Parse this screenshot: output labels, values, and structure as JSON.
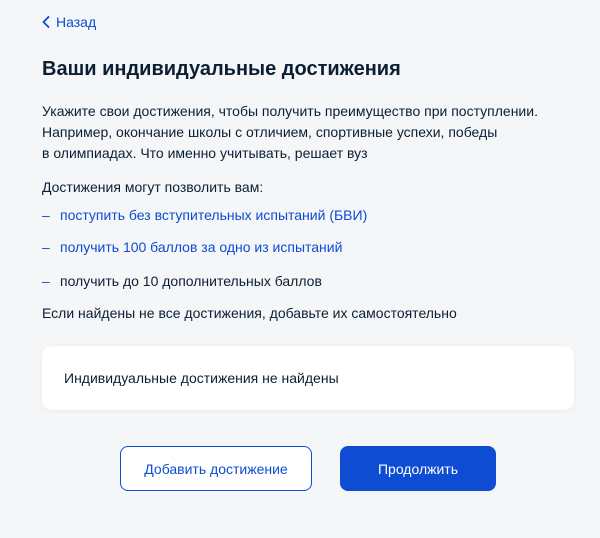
{
  "nav": {
    "back_label": "Назад"
  },
  "title": "Ваши индивидуальные достижения",
  "intro": {
    "line1": "Укажите свои достижения, чтобы получить преимущество при поступлении.",
    "line2": "Например, окончание школы с отличием, спортивные успехи, победы",
    "line3": "в олимпиадах. Что именно учитывать, решает вуз"
  },
  "benefits_label": "Достижения могут позволить вам:",
  "benefits": [
    {
      "dash": "–",
      "text": "поступить без вступительных испытаний (БВИ)"
    },
    {
      "dash": "–",
      "text": "получить 100 баллов за одно из испытаний"
    },
    {
      "dash": "–",
      "text": "получить до 10 дополнительных баллов"
    }
  ],
  "notice": "Если найдены не все достижения, добавьте их самостоятельно",
  "empty_card": {
    "text": "Индивидуальные достижения не найдены"
  },
  "actions": {
    "add_label": "Добавить достижение",
    "continue_label": "Продолжить"
  },
  "colors": {
    "accent": "#0d4cd3",
    "text": "#0b1f33",
    "background": "#f4f6f8",
    "card": "#ffffff"
  }
}
